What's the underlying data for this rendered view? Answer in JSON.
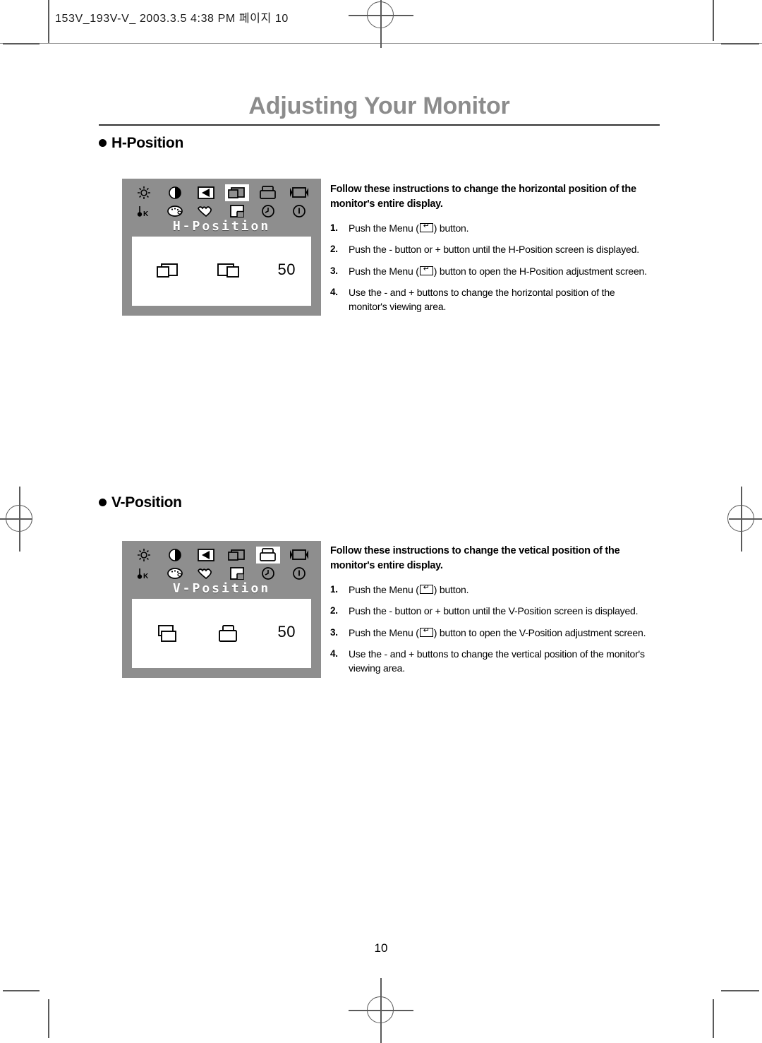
{
  "print_header": {
    "text": "153V_193V-V_  2003.3.5 4:38 PM  페이지 10"
  },
  "document": {
    "title": "Adjusting Your Monitor",
    "page_number": "10",
    "title_color": "#8c8c8c"
  },
  "sections": [
    {
      "heading": "H-Position",
      "osd": {
        "menu_label": "H-Position",
        "value": "50",
        "selected_icon_index": 3,
        "background_color": "#8e8e8e",
        "icons_row1": [
          "brightness-icon",
          "contrast-icon",
          "sharpness-icon",
          "h-position-icon",
          "v-position-icon",
          "h-size-icon"
        ],
        "icons_row2": [
          "color-temperature-icon",
          "color-palette-icon",
          "color-adjust-icon",
          "osd-position-icon",
          "clock-phase-icon",
          "information-icon"
        ],
        "value_icon_left": "h-position-left-icon",
        "value_icon_right": "h-position-right-icon"
      },
      "intro": "Follow these instructions to change the horizontal position of the monitor's entire display.",
      "steps": [
        {
          "num": "1.",
          "before": "Push the Menu (",
          "after": ") button.",
          "has_menu_glyph": true
        },
        {
          "num": "2.",
          "before": "Push the - button or + button until the H-Position screen is displayed.",
          "after": "",
          "has_menu_glyph": false
        },
        {
          "num": "3.",
          "before": "Push the Menu (",
          "after": ") button to open the H-Position adjustment screen.",
          "has_menu_glyph": true
        },
        {
          "num": "4.",
          "before": "Use the - and + buttons to change the horizontal position of the monitor's viewing area.",
          "after": "",
          "has_menu_glyph": false
        }
      ]
    },
    {
      "heading": "V-Position",
      "osd": {
        "menu_label": "V-Position",
        "value": "50",
        "selected_icon_index": 4,
        "background_color": "#8e8e8e",
        "icons_row1": [
          "brightness-icon",
          "contrast-icon",
          "sharpness-icon",
          "h-position-icon",
          "v-position-icon",
          "h-size-icon"
        ],
        "icons_row2": [
          "color-temperature-icon",
          "color-palette-icon",
          "color-adjust-icon",
          "osd-position-icon",
          "clock-phase-icon",
          "information-icon"
        ],
        "value_icon_left": "v-position-down-icon",
        "value_icon_right": "v-position-up-icon"
      },
      "intro": "Follow these instructions to change the vetical position of the monitor's entire display.",
      "steps": [
        {
          "num": "1.",
          "before": "Push the Menu (",
          "after": ") button.",
          "has_menu_glyph": true
        },
        {
          "num": "2.",
          "before": "Push the - button or + button until the V-Position screen is displayed.",
          "after": "",
          "has_menu_glyph": false
        },
        {
          "num": "3.",
          "before": "Push the Menu (",
          "after": ") button to open the V-Position adjustment screen.",
          "has_menu_glyph": true
        },
        {
          "num": "4.",
          "before": "Use the - and + buttons to change the vertical position of the monitor's viewing area.",
          "after": "",
          "has_menu_glyph": false
        }
      ]
    }
  ]
}
